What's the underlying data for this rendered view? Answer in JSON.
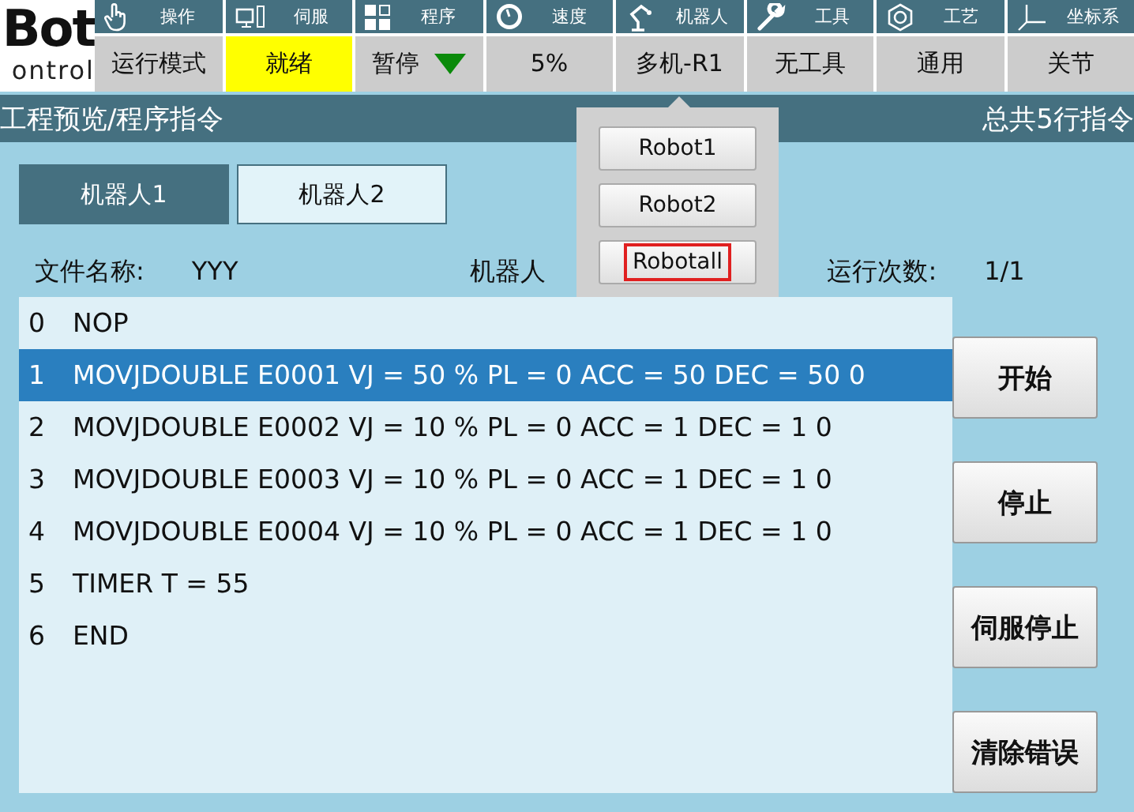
{
  "logo": {
    "line1": "Bot",
    "line2": "ontrol"
  },
  "menu": [
    {
      "label": "操作"
    },
    {
      "label": "伺服"
    },
    {
      "label": "程序"
    },
    {
      "label": "速度"
    },
    {
      "label": "机器人"
    },
    {
      "label": "工具"
    },
    {
      "label": "工艺"
    },
    {
      "label": "坐标系"
    }
  ],
  "status": [
    {
      "kind": "text",
      "text": "运行模式"
    },
    {
      "kind": "status",
      "text": "就绪",
      "color": "#ffff00"
    },
    {
      "kind": "dropdown",
      "text": "暂停"
    },
    {
      "kind": "text",
      "text": "5%"
    },
    {
      "kind": "text",
      "text": "多机-R1"
    },
    {
      "kind": "text",
      "text": "无工具"
    },
    {
      "kind": "text",
      "text": "通用"
    },
    {
      "kind": "text",
      "text": "关节"
    }
  ],
  "title": "工程预览/程序指令",
  "title_right": "总共5行指令",
  "tabs": [
    {
      "label": "机器人1",
      "selected": true
    },
    {
      "label": "机器人2",
      "selected": false
    }
  ],
  "info": [
    {
      "label": "文件名称:",
      "value": "YYY"
    },
    {
      "label": "机器人"
    },
    {
      "label": "运行次数:",
      "value": "1/1"
    }
  ],
  "lines": [
    {
      "number": "0",
      "text": "NOP",
      "selected": false
    },
    {
      "number": "1",
      "text": "MOVJDOUBLE E0001 VJ = 50 % PL = 0 ACC = 50 DEC = 50 0",
      "selected": true
    },
    {
      "number": "2",
      "text": "MOVJDOUBLE E0002 VJ = 10 % PL = 0 ACC = 1 DEC = 1 0",
      "selected": false
    },
    {
      "number": "3",
      "text": "MOVJDOUBLE E0003 VJ = 10 % PL = 0 ACC = 1 DEC = 1 0",
      "selected": false
    },
    {
      "number": "4",
      "text": "MOVJDOUBLE E0004 VJ = 10 % PL = 0 ACC = 1 DEC = 1 0",
      "selected": false
    },
    {
      "number": "5",
      "text": "TIMER T = 55",
      "selected": false
    },
    {
      "number": "6",
      "text": "END",
      "selected": false
    }
  ],
  "actions": [
    "开始",
    "停止",
    "伺服停止",
    "清除错误"
  ],
  "popup": [
    {
      "label": "Robot1",
      "selected": false
    },
    {
      "label": "Robot2",
      "selected": false
    },
    {
      "label": "Robotall",
      "selected": true
    }
  ]
}
